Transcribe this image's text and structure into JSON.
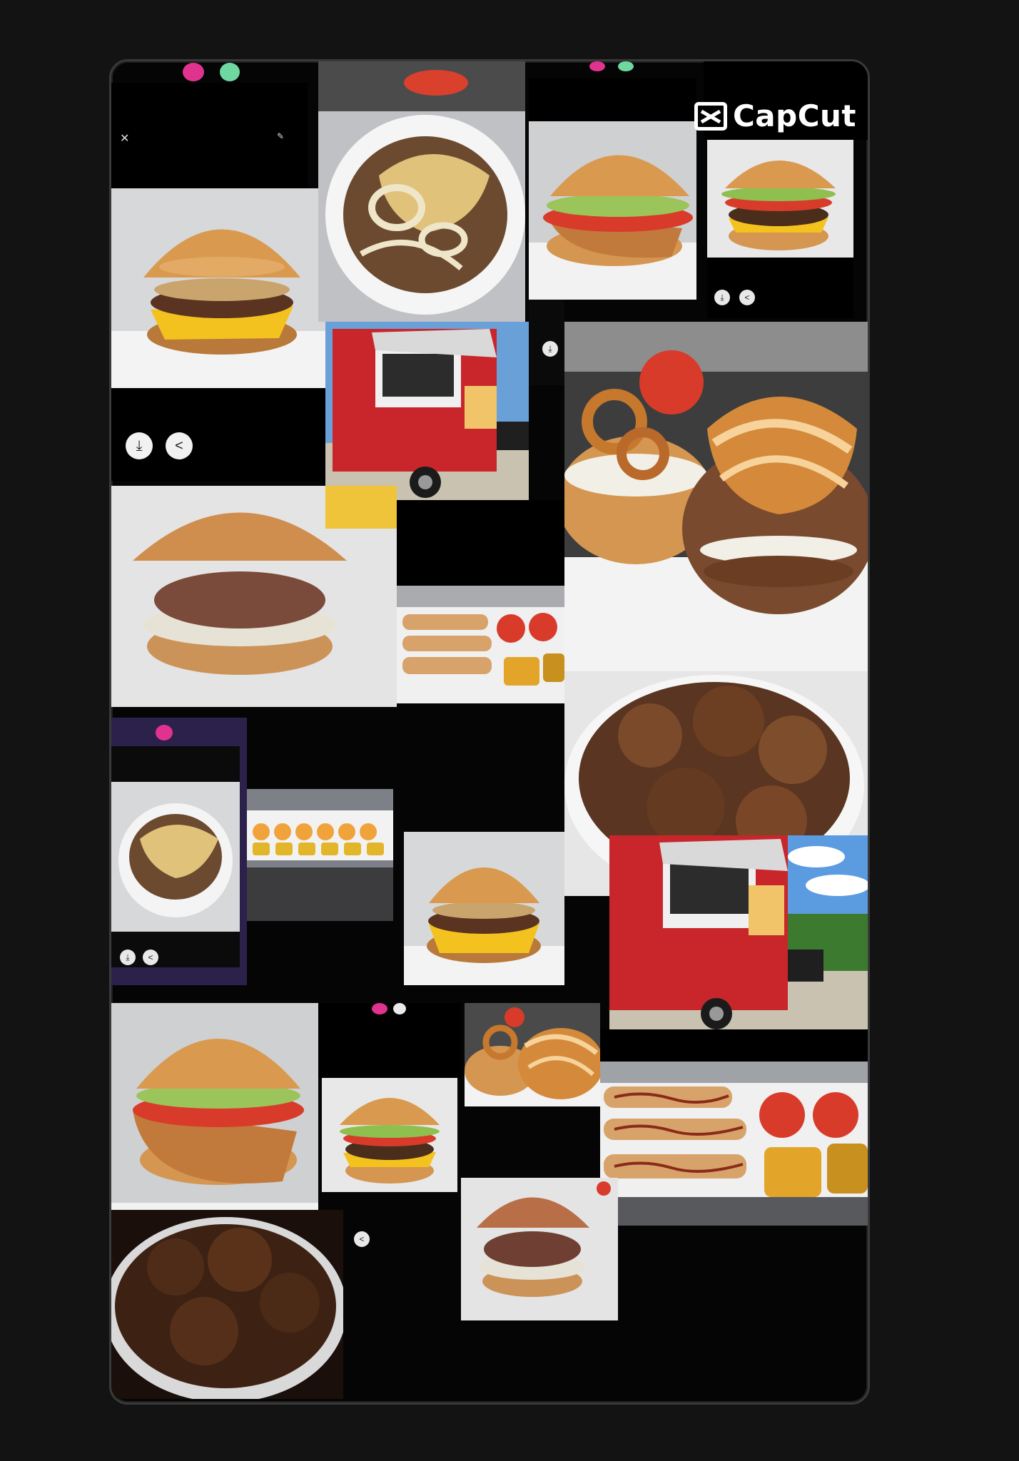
{
  "watermark": {
    "brand": "CapCut"
  },
  "icons": {
    "close": "close-icon",
    "download": "download-icon",
    "share": "share-icon",
    "edit": "edit-icon"
  },
  "colors": {
    "background": "#131313",
    "frame": "#050505",
    "truck_red": "#c8262b",
    "cheese": "#f4c21e",
    "bun": "#d99a4f",
    "app_pink": "#e0338f",
    "app_green": "#6fd8a0"
  }
}
